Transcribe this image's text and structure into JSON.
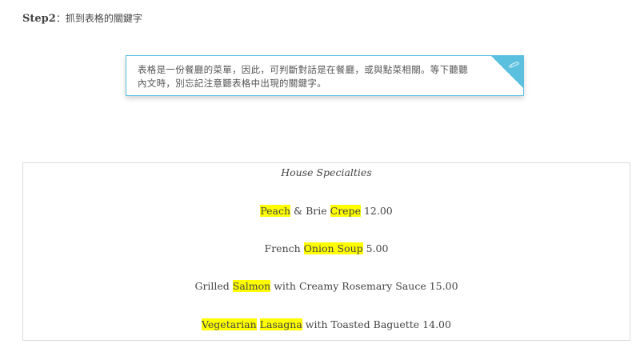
{
  "step": {
    "label": "Step2",
    "separator": "：",
    "text": "抓到表格的關鍵字"
  },
  "note": {
    "text": "表格是一份餐廳的菜單，因此，可判斷對話是在餐廳，或與點菜相關。等下聽聽內文時，別忘記注意聽表格中出現的關鍵字。",
    "corner_icon": "pin-icon",
    "accent_color": "#5bc0de"
  },
  "menu": {
    "title": "House Specialties",
    "highlight_color": "#ffff00",
    "items": [
      {
        "parts": [
          {
            "text": "Peach",
            "highlight": true
          },
          {
            "text": " & Brie ",
            "highlight": false
          },
          {
            "text": "Crepe",
            "highlight": true
          },
          {
            "text": " 12.00",
            "highlight": false
          }
        ]
      },
      {
        "parts": [
          {
            "text": "French ",
            "highlight": false
          },
          {
            "text": "Onion Soup",
            "highlight": true
          },
          {
            "text": " 5.00",
            "highlight": false
          }
        ]
      },
      {
        "parts": [
          {
            "text": "Grilled ",
            "highlight": false
          },
          {
            "text": "Salmon",
            "highlight": true
          },
          {
            "text": " with Creamy Rosemary Sauce 15.00",
            "highlight": false
          }
        ]
      },
      {
        "parts": [
          {
            "text": "Vegetarian",
            "highlight": true
          },
          {
            "text": " ",
            "highlight": false
          },
          {
            "text": "Lasagna",
            "highlight": true
          },
          {
            "text": " with Toasted Baguette 14.00",
            "highlight": false
          }
        ]
      }
    ]
  }
}
